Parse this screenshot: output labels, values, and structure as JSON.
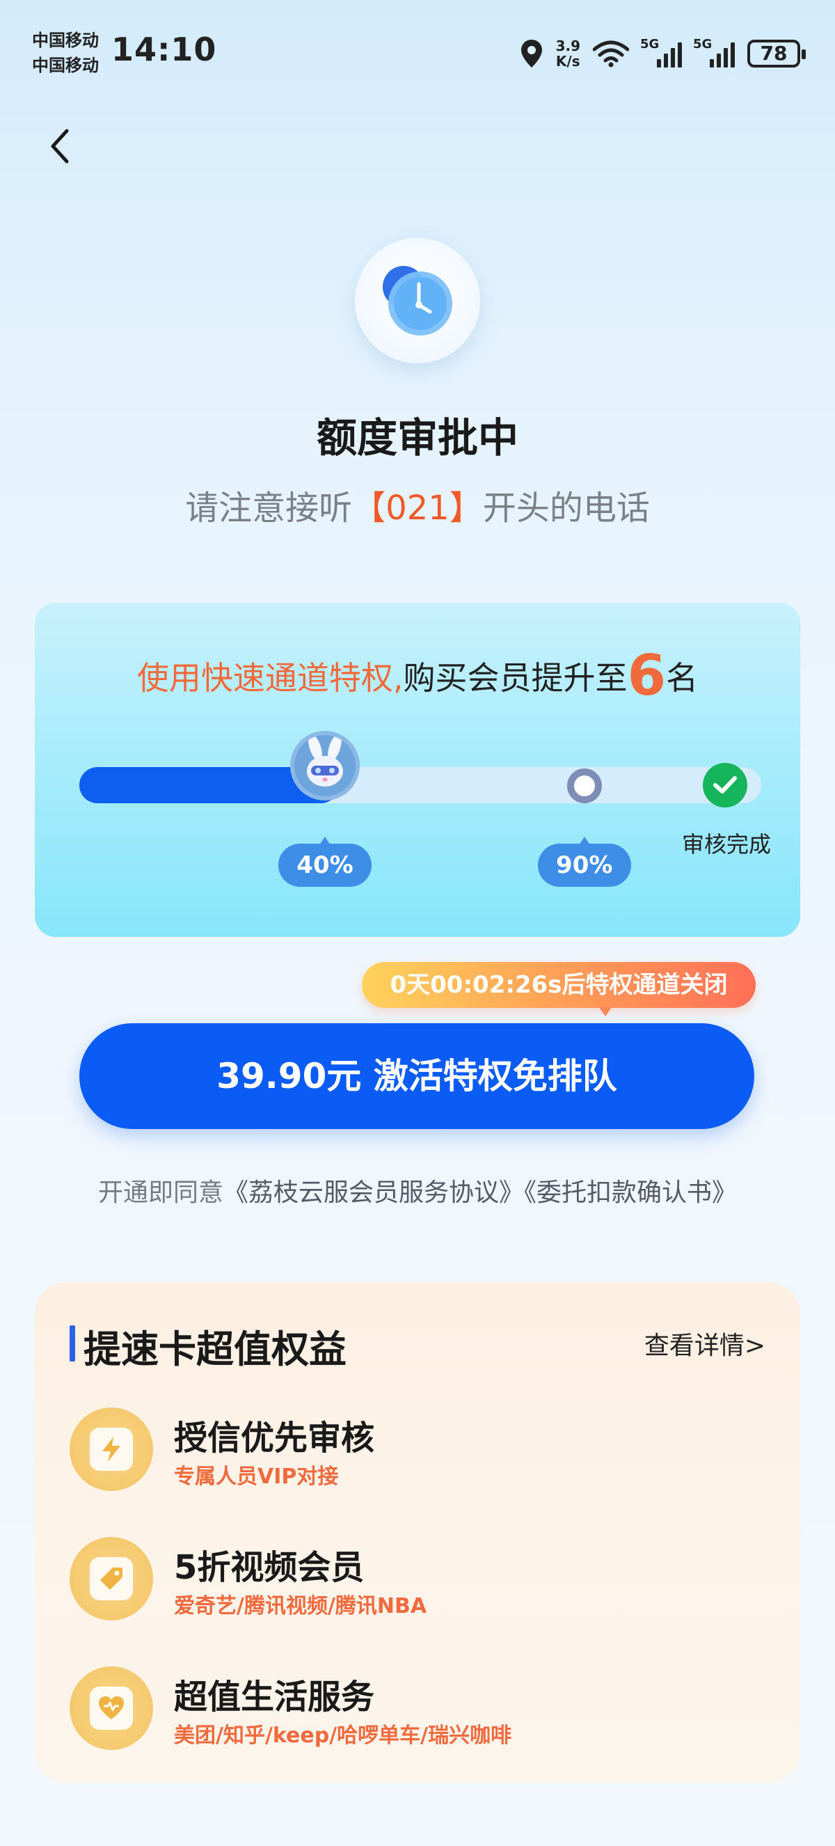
{
  "status_bar": {
    "carrier_1": "中国移动",
    "carrier_2": "中国移动",
    "time": "14:10",
    "net_speed_value": "3.9",
    "net_speed_unit": "K/s",
    "network_1": "5G",
    "network_2": "5G",
    "battery": "78"
  },
  "header": {
    "back_icon": "chevron-left-icon",
    "status_icon": "clock-icon",
    "title": "额度审批中",
    "subtitle_prefix": "请注意接听",
    "subtitle_highlight": "【021】",
    "subtitle_suffix": "开头的电话"
  },
  "progress_card": {
    "promo_orange": "使用快速通道特权,",
    "promo_black": "购买会员提升至",
    "rank_number": "6",
    "rank_unit": "名",
    "current_progress": 0.4,
    "current_label": "40%",
    "target_progress": 0.9,
    "target_label": "90%",
    "done_label": "审核完成",
    "colors": {
      "fill": "#0e5ff0",
      "track": "#d4ecfb",
      "done": "#16b45b"
    }
  },
  "cta": {
    "countdown": "0天00:02:26s后特权通道关闭",
    "button_label": "39.90元 激活特权免排队",
    "agreement_prefix": "开通即同意",
    "agreement_link_1": "《荔枝云服会员服务协议》",
    "agreement_link_2": "《委托扣款确认书》"
  },
  "benefits": {
    "title": "提速卡超值权益",
    "details_link": "查看详情>",
    "items": [
      {
        "name": "授信优先审核",
        "desc": "专属人员VIP对接",
        "icon": "lightning-icon"
      },
      {
        "name": "5折视频会员",
        "desc": "爱奇艺/腾讯视频/腾讯NBA",
        "icon": "tag-icon"
      },
      {
        "name": "超值生活服务",
        "desc": "美团/知乎/keep/哈啰单车/瑞兴咖啡",
        "icon": "heart-icon"
      }
    ]
  },
  "theme": {
    "primary_blue": "#0b5bf5",
    "accent_orange": "#ef5a2a"
  }
}
